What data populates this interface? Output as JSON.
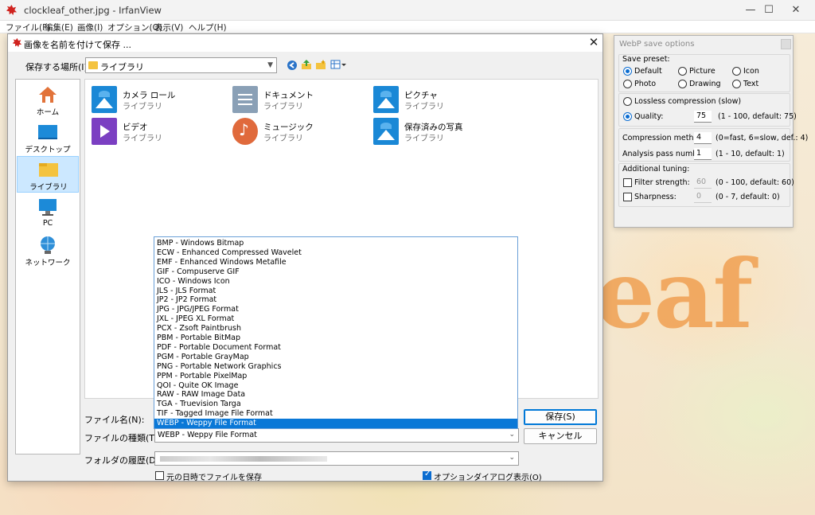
{
  "window": {
    "title": "clockleaf_other.jpg - IrfanView",
    "minimize": "—",
    "maximize": "☐",
    "close": "✕"
  },
  "menu": [
    "ファイル(F)",
    "編集(E)",
    "画像(I)",
    "オプション(O)",
    "表示(V)",
    "ヘルプ(H)"
  ],
  "background_word": "eaf",
  "dialog": {
    "title": "画像を名前を付けて保存 ...",
    "close": "✕",
    "location_label": "保存する場所(I):",
    "location_value": "ライブラリ",
    "places": [
      {
        "label": "ホーム",
        "icon": "home-icon"
      },
      {
        "label": "デスクトップ",
        "icon": "desktop-icon"
      },
      {
        "label": "ライブラリ",
        "icon": "library-icon",
        "selected": true
      },
      {
        "label": "PC",
        "icon": "pc-icon"
      },
      {
        "label": "ネットワーク",
        "icon": "network-icon"
      }
    ],
    "libraries": [
      {
        "name": "カメラ ロール",
        "sub": "ライブラリ",
        "icon": "pictures-icon"
      },
      {
        "name": "ドキュメント",
        "sub": "ライブラリ",
        "icon": "documents-icon"
      },
      {
        "name": "ピクチャ",
        "sub": "ライブラリ",
        "icon": "pictures-icon"
      },
      {
        "name": "ビデオ",
        "sub": "ライブラリ",
        "icon": "video-icon"
      },
      {
        "name": "ミュージック",
        "sub": "ライブラリ",
        "icon": "music-icon"
      },
      {
        "name": "保存済みの写真",
        "sub": "ライブラリ",
        "icon": "pictures-icon"
      }
    ],
    "filename_label": "ファイル名(N):",
    "filetype_label": "ファイルの種類(T):",
    "filetype_value": "WEBP - Weppy File Format",
    "filetypes": [
      "BMP - Windows Bitmap",
      "ECW - Enhanced Compressed Wavelet",
      "EMF - Enhanced Windows Metafile",
      "GIF - Compuserve GIF",
      "ICO - Windows Icon",
      "JLS - JLS Format",
      "JP2 - JP2 Format",
      "JPG - JPG/JPEG Format",
      "JXL - JPEG XL Format",
      "PCX - Zsoft Paintbrush",
      "PBM - Portable BitMap",
      "PDF - Portable Document Format",
      "PGM - Portable GrayMap",
      "PNG - Portable Network Graphics",
      "PPM - Portable PixelMap",
      "QOI - Quite OK Image",
      "RAW - RAW Image Data",
      "TGA - Truevision Targa",
      "TIF - Tagged Image File Format",
      "WEBP - Weppy File Format"
    ],
    "selected_filetype": "WEBP - Weppy File Format",
    "save_button": "保存(S)",
    "cancel_button": "キャンセル",
    "history_label": "フォルダの履歴(D):",
    "keep_date_label": "元の日時でファイルを保存",
    "keep_date_checked": false,
    "show_options_label": "オプションダイアログ表示(O)",
    "show_options_checked": true
  },
  "webp": {
    "title": "WebP save options",
    "preset_label": "Save preset:",
    "presets": [
      "Default",
      "Picture",
      "Icon",
      "Photo",
      "Drawing",
      "Text"
    ],
    "selected_preset": "Default",
    "lossless_label": "Lossless compression (slow)",
    "quality_label": "Quality:",
    "quality_value": "75",
    "quality_hint": "(1 - 100, default: 75)",
    "method_label": "Compression method:",
    "method_value": "4",
    "method_hint": "(0=fast, 6=slow, def.: 4)",
    "pass_label": "Analysis pass number:",
    "pass_value": "1",
    "pass_hint": "(1 - 10, default: 1)",
    "tuning_label": "Additional tuning:",
    "filter_label": "Filter strength:",
    "filter_value": "60",
    "filter_hint": "(0 - 100, default: 60)",
    "sharp_label": "Sharpness:",
    "sharp_value": "0",
    "sharp_hint": "(0 - 7, default: 0)"
  },
  "colors": {
    "accent": "#0078d7",
    "selection": "#0a78d7",
    "background_word": "#f0a052"
  }
}
